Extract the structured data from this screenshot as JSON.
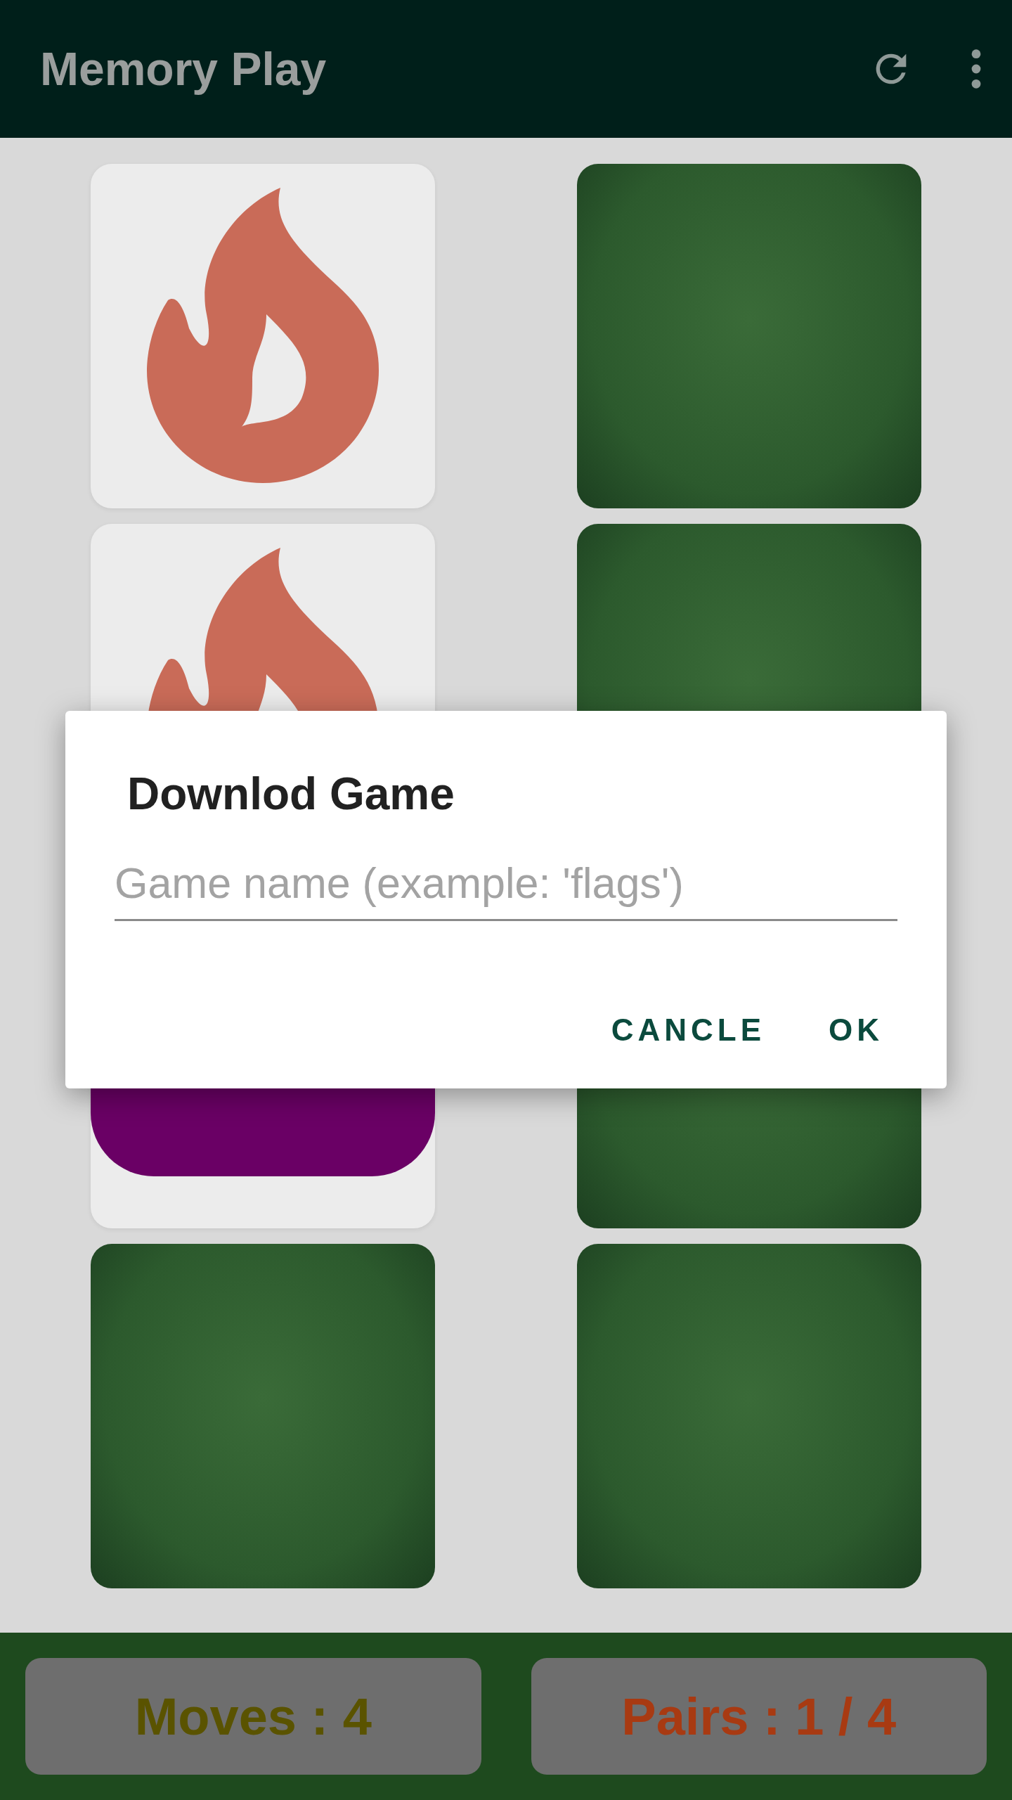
{
  "app_bar": {
    "title": "Memory Play"
  },
  "cards": [
    {
      "kind": "flame"
    },
    {
      "kind": "back"
    },
    {
      "kind": "flame"
    },
    {
      "kind": "back"
    },
    {
      "kind": "block"
    },
    {
      "kind": "back"
    },
    {
      "kind": "back"
    },
    {
      "kind": "back"
    }
  ],
  "score": {
    "moves": "Moves : 4",
    "pairs": "Pairs : 1 / 4"
  },
  "dialog": {
    "title": "Downlod Game",
    "placeholder": "Game name (example: 'flags')",
    "buttons": [
      "CANCLE",
      "OK"
    ]
  }
}
